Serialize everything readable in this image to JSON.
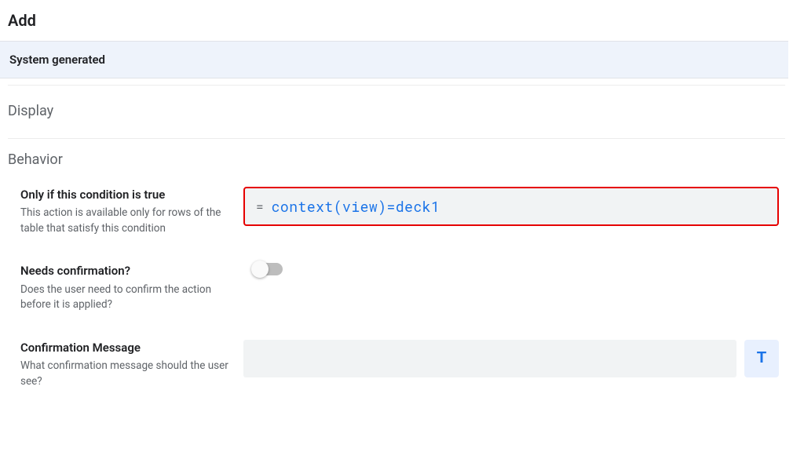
{
  "page": {
    "title": "Add"
  },
  "banner": {
    "text": "System generated"
  },
  "sections": {
    "display": {
      "header": "Display"
    },
    "behavior": {
      "header": "Behavior",
      "condition": {
        "label": "Only if this condition is true",
        "desc": "This action is available only for rows of the table that satisfy this condition",
        "prefix": "=",
        "expression": "context(view)=deck1"
      },
      "needs_confirm": {
        "label": "Needs confirmation?",
        "desc": "Does the user need to confirm the action before it is applied?",
        "value": false
      },
      "confirm_msg": {
        "label": "Confirmation Message",
        "desc": "What confirmation message should the user see?",
        "value": "",
        "format_btn": "T"
      }
    }
  }
}
